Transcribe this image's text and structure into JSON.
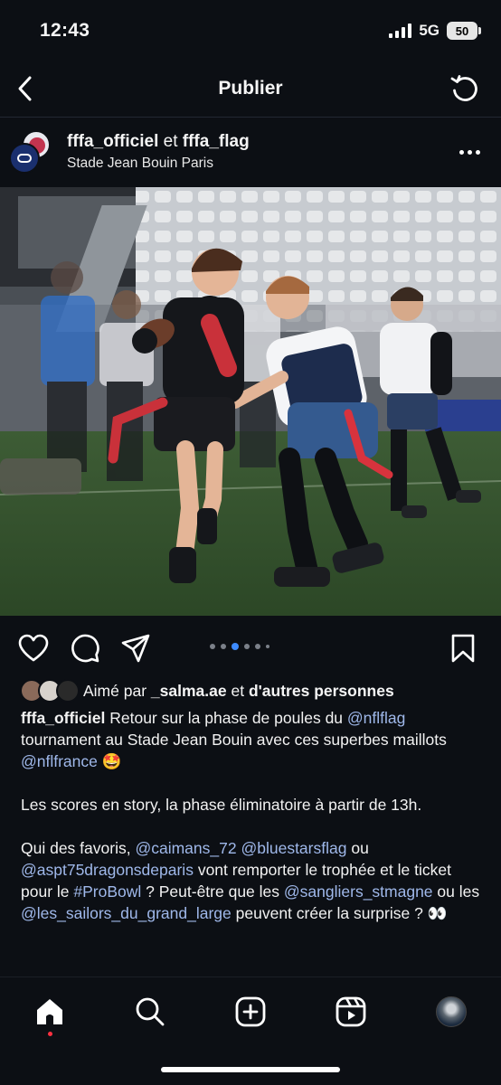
{
  "status_bar": {
    "time": "12:43",
    "network": "5G",
    "battery": "50"
  },
  "header": {
    "title": "Publier"
  },
  "post": {
    "account_primary": "fffa_officiel",
    "connector": "et",
    "account_secondary": "fffa_flag",
    "location": "Stade Jean Bouin Paris",
    "carousel": {
      "count": 6,
      "active_index": 2
    }
  },
  "likes": {
    "prefix": "Aimé par",
    "user": "_salma.ae",
    "connector": "et",
    "others": "d'autres personnes"
  },
  "caption": {
    "author": "fffa_officiel",
    "p1": [
      {
        "t": "Retour sur la phase de poules du "
      },
      {
        "t": "@nflflag",
        "m": true
      },
      {
        "t": " tournament au Stade Jean Bouin avec ces superbes maillots "
      },
      {
        "t": "@nflfrance",
        "m": true
      },
      {
        "t": " 🤩"
      }
    ],
    "p2": [
      {
        "t": "Les scores en story, la phase éliminatoire à partir de 13h."
      }
    ],
    "p3": [
      {
        "t": "Qui des favoris, "
      },
      {
        "t": "@caimans_72",
        "m": true
      },
      {
        "t": " "
      },
      {
        "t": "@bluestarsflag",
        "m": true
      },
      {
        "t": " ou "
      },
      {
        "t": "@aspt75dragonsdeparis",
        "m": true
      },
      {
        "t": " vont remporter le trophée et le ticket pour le "
      },
      {
        "t": "#ProBowl",
        "m": true
      },
      {
        "t": " ? Peut-être que les "
      },
      {
        "t": "@sangliers_stmagne",
        "m": true
      },
      {
        "t": " ou les "
      },
      {
        "t": "@les_sailors_du_grand_large",
        "m": true
      },
      {
        "t": " peuvent créer la surprise ? 👀"
      }
    ]
  },
  "colors": {
    "background": "#0c0f14",
    "mention": "#9fb8ea",
    "active_dot": "#3d8bff",
    "notification": "#ff3040"
  },
  "icons": {
    "header": [
      "back-arrow-icon",
      "refresh-icon"
    ],
    "actions": [
      "heart-icon",
      "comment-icon",
      "share-icon",
      "bookmark-icon"
    ],
    "nav": [
      "home-icon",
      "search-icon",
      "create-icon",
      "reels-icon",
      "profile-avatar"
    ]
  }
}
